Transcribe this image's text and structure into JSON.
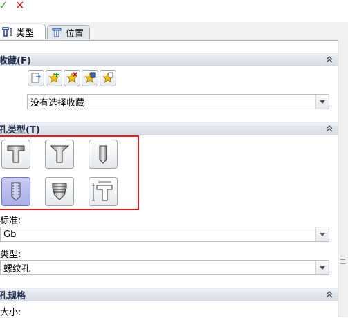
{
  "toolbar": {
    "ok_icon": "green-check-icon",
    "cancel_icon": "red-x-icon"
  },
  "tabs": [
    {
      "label": "类型",
      "icon": "hole-type-icon",
      "active": true
    },
    {
      "label": "位置",
      "icon": "position-icon",
      "active": false
    }
  ],
  "favorites": {
    "title": "收藏(F)",
    "buttons": [
      "apply-default-icon",
      "add-favorite-icon",
      "delete-favorite-icon",
      "save-favorite-icon",
      "load-favorite-icon"
    ],
    "combo_value": "没有选择收藏"
  },
  "hole_type": {
    "title": "孔类型(T)",
    "buttons": [
      {
        "icon": "counterbore-icon",
        "selected": false
      },
      {
        "icon": "countersink-icon",
        "selected": false
      },
      {
        "icon": "hole-icon",
        "selected": false
      },
      {
        "icon": "tapped-hole-icon",
        "selected": true
      },
      {
        "icon": "pipe-tap-icon",
        "selected": false
      },
      {
        "icon": "legacy-hole-icon",
        "selected": false
      }
    ],
    "standard_label": "标准:",
    "standard_value": "Gb",
    "type_label": "类型:",
    "type_value": "螺纹孔"
  },
  "hole_spec": {
    "title": "孔规格",
    "size_label": "大小:"
  },
  "colors": {
    "accent_red": "#e01e1e",
    "selected": "#a9aee7"
  }
}
